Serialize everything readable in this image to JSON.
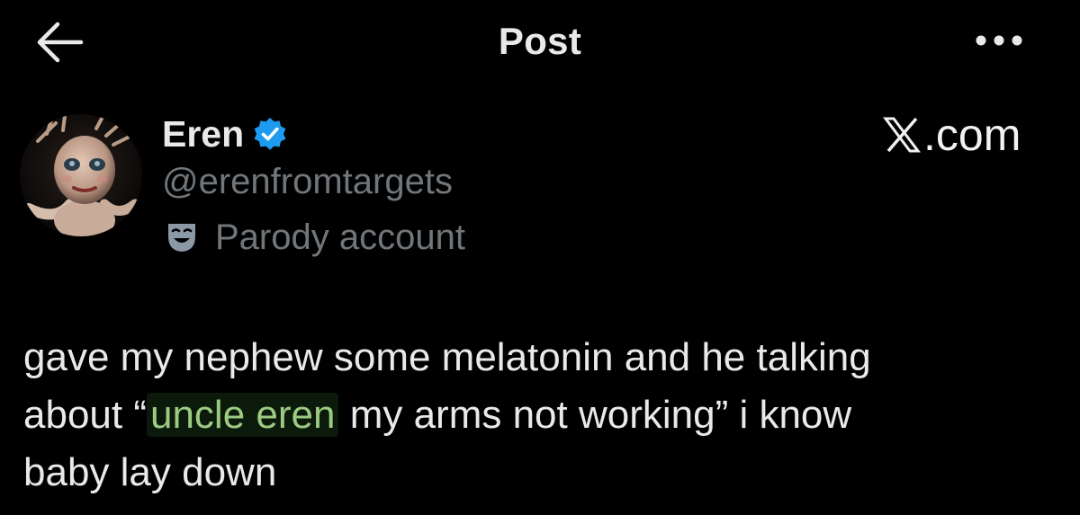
{
  "header": {
    "title": "Post",
    "back_icon": "arrow-left-icon",
    "more_icon": "ellipsis-icon"
  },
  "author": {
    "name": "Eren",
    "handle": "@erenfromtargets",
    "verified": true,
    "verified_color": "#1d9bf0",
    "label_icon": "theater-mask-icon",
    "label": "Parody account"
  },
  "watermark": {
    "logo_letter": "X",
    "text": ".com"
  },
  "post": {
    "line1": "gave my nephew some melatonin and he talking",
    "line2_before": "about “",
    "line2_highlight": "uncle eren",
    "line2_after": " my arms not working” i know",
    "line3": "baby lay down"
  },
  "colors": {
    "background": "#000000",
    "text": "#e7e9ea",
    "secondary": "#71767b",
    "highlight_text": "#9cca82"
  }
}
